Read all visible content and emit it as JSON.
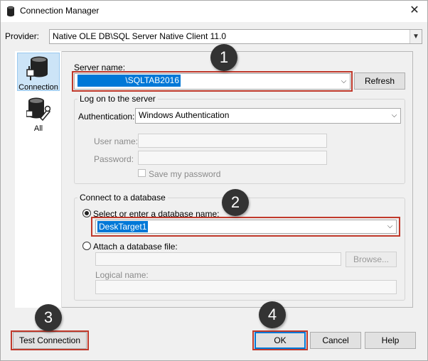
{
  "window": {
    "title": "Connection Manager",
    "close_glyph": "✕"
  },
  "provider": {
    "label": "Provider:",
    "value": "Native OLE DB\\SQL Server Native Client 11.0"
  },
  "sidebar": {
    "items": [
      {
        "label": "Connection",
        "icon": "database-plug-icon",
        "active": true
      },
      {
        "label": "All",
        "icon": "database-wrench-icon",
        "active": false
      }
    ]
  },
  "server": {
    "label": "Server name:",
    "value": "\\SQLTAB2016",
    "refresh_label": "Refresh"
  },
  "logon": {
    "group_title": "Log on to the server",
    "auth_label": "Authentication:",
    "auth_value": "Windows Authentication",
    "username_label": "User name:",
    "password_label": "Password:",
    "save_password_label": "Save my password"
  },
  "database": {
    "group_title": "Connect to a database",
    "select_label": "Select or enter a database name:",
    "select_value": "DeskTarget1",
    "attach_label": "Attach a database file:",
    "browse_label": "Browse...",
    "logical_name_label": "Logical name:"
  },
  "footer": {
    "test_connection_label": "Test Connection",
    "ok_label": "OK",
    "cancel_label": "Cancel",
    "help_label": "Help"
  },
  "callouts": [
    "1",
    "2",
    "3",
    "4"
  ],
  "colors": {
    "selection": "#0078d7",
    "annotation_box": "#c0392b",
    "callout_bg": "#333333"
  }
}
